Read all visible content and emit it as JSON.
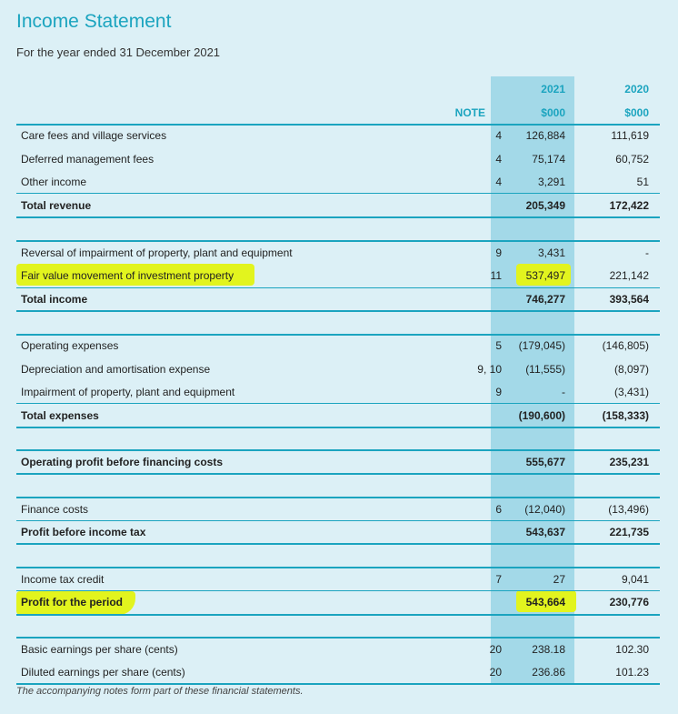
{
  "title": "Income Statement",
  "subtitle": "For the year ended 31 December 2021",
  "headers": {
    "year_2021": "2021",
    "year_2020": "2020",
    "note": "NOTE",
    "unit_2021": "$000",
    "unit_2020": "$000"
  },
  "rows": [
    {
      "label": "Care fees and village services",
      "note": "4",
      "v2021": "126,884",
      "v2020": "111,619"
    },
    {
      "label": "Deferred management fees",
      "note": "4",
      "v2021": "75,174",
      "v2020": "60,752"
    },
    {
      "label": "Other income",
      "note": "4",
      "v2021": "3,291",
      "v2020": "51"
    },
    {
      "label": "Total revenue",
      "note": "",
      "v2021": "205,349",
      "v2020": "172,422"
    },
    {
      "label": "Reversal of impairment of property, plant and equipment",
      "note": "9",
      "v2021": "3,431",
      "v2020": "-"
    },
    {
      "label": "Fair value movement of investment property",
      "note": "11",
      "v2021": "537,497",
      "v2020": "221,142"
    },
    {
      "label": "Total income",
      "note": "",
      "v2021": "746,277",
      "v2020": "393,564"
    },
    {
      "label": "Operating expenses",
      "note": "5",
      "v2021": "(179,045)",
      "v2020": "(146,805)"
    },
    {
      "label": "Depreciation and amortisation expense",
      "note": "9, 10",
      "v2021": "(11,555)",
      "v2020": "(8,097)"
    },
    {
      "label": "Impairment of property, plant and equipment",
      "note": "9",
      "v2021": "-",
      "v2020": "(3,431)"
    },
    {
      "label": "Total expenses",
      "note": "",
      "v2021": "(190,600)",
      "v2020": "(158,333)"
    },
    {
      "label": "Operating profit before financing costs",
      "note": "",
      "v2021": "555,677",
      "v2020": "235,231"
    },
    {
      "label": "Finance costs",
      "note": "6",
      "v2021": "(12,040)",
      "v2020": "(13,496)"
    },
    {
      "label": "Profit before income tax",
      "note": "",
      "v2021": "543,637",
      "v2020": "221,735"
    },
    {
      "label": "Income tax credit",
      "note": "7",
      "v2021": "27",
      "v2020": "9,041"
    },
    {
      "label": "Profit for the period",
      "note": "",
      "v2021": "543,664",
      "v2020": "230,776"
    },
    {
      "label": "Basic earnings per share (cents)",
      "note": "20",
      "v2021": "238.18",
      "v2020": "102.30"
    },
    {
      "label": "Diluted earnings per share (cents)",
      "note": "20",
      "v2021": "236.86",
      "v2020": "101.23"
    }
  ],
  "footnote": "The accompanying notes form part of these financial statements.",
  "colors": {
    "accent": "#1ba4bf",
    "column_2021": "#a3d9e8",
    "highlight": "#e2f41e",
    "background": "#dcf0f6"
  }
}
